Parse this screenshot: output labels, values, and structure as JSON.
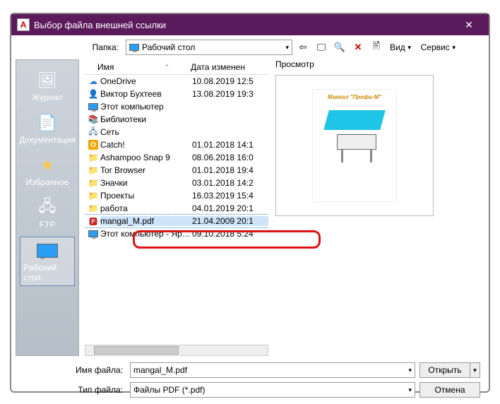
{
  "window": {
    "title": "Выбор файла внешней ссылки",
    "app_icon_letter": "A"
  },
  "toolbar": {
    "folder_label": "Папка:",
    "folder_value": "Рабочий стол",
    "view_label": "Вид",
    "tools_label": "Сервис"
  },
  "columns": {
    "name": "Имя",
    "date": "Дата изменен"
  },
  "files": [
    {
      "icon": "cloud",
      "name": "OneDrive",
      "date": "10.08.2019 12:5"
    },
    {
      "icon": "user",
      "name": "Виктор Бухтеев",
      "date": "13.08.2019 19:3"
    },
    {
      "icon": "pc",
      "name": "Этот компьютер",
      "date": ""
    },
    {
      "icon": "lib",
      "name": "Библиотеки",
      "date": ""
    },
    {
      "icon": "net",
      "name": "Сеть",
      "date": ""
    },
    {
      "icon": "catch",
      "name": "Catch!",
      "date": "01.01.2018 14:1"
    },
    {
      "icon": "folder",
      "name": "Ashampoo Snap 9",
      "date": "08.06.2018 16:0"
    },
    {
      "icon": "folder",
      "name": "Tor Browser",
      "date": "01.01.2018 19:4"
    },
    {
      "icon": "folder",
      "name": "Значки",
      "date": "03.01.2018 14:2"
    },
    {
      "icon": "folder",
      "name": "Проекты",
      "date": "16.03.2019 15:4"
    },
    {
      "icon": "folder",
      "name": "работа",
      "date": "04.01.2019 20:1"
    },
    {
      "icon": "pdf",
      "name": "mangal_M.pdf",
      "date": "21.04.2009 20:1"
    },
    {
      "icon": "pc",
      "name": "Этот компьютер - Яр…",
      "date": "09.10.2018 5:24"
    }
  ],
  "selected_index": 11,
  "sidebar": [
    {
      "label": "Журнал"
    },
    {
      "label": "Документация"
    },
    {
      "label": "Избранное"
    },
    {
      "label": "FTP"
    },
    {
      "label": "Рабочий стол"
    }
  ],
  "sidebar_active": 4,
  "preview": {
    "label": "Просмотр",
    "doc_title": "Мангал \"Профи-М\""
  },
  "bottom": {
    "filename_label": "Имя файла:",
    "filename_value": "mangal_M.pdf",
    "filetype_label": "Тип файла:",
    "filetype_value": "Файлы PDF (*.pdf)",
    "open": "Открыть",
    "cancel": "Отмена"
  }
}
